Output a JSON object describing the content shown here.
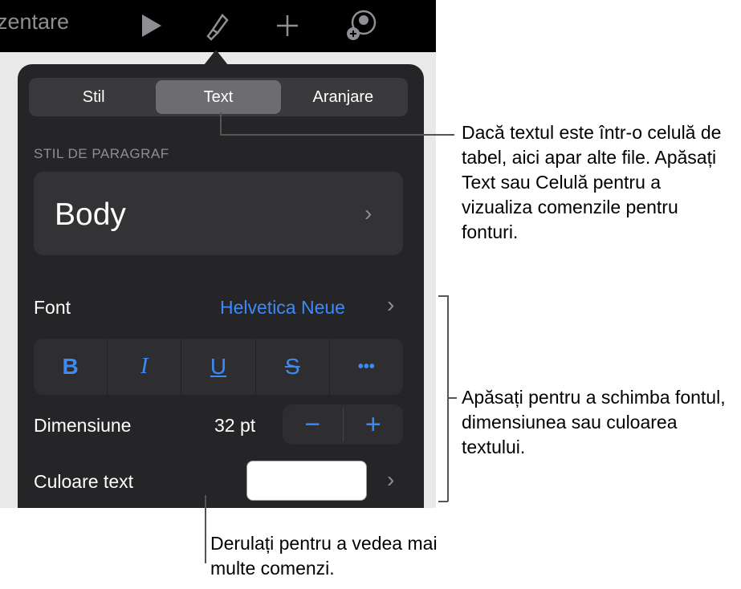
{
  "toolbar": {
    "title_partial": "zentare",
    "icons": [
      "play-icon",
      "paintbrush-icon",
      "plus-icon",
      "add-collaborator-icon"
    ]
  },
  "tabs": [
    {
      "label": "Stil"
    },
    {
      "label": "Text",
      "active": true
    },
    {
      "label": "Aranjare"
    }
  ],
  "paragraph": {
    "section_label": "STIL DE PARAGRAF",
    "value": "Body"
  },
  "font": {
    "label": "Font",
    "value": "Helvetica Neue"
  },
  "format_buttons": [
    {
      "label": "B",
      "name": "bold"
    },
    {
      "label": "I",
      "name": "italic"
    },
    {
      "label": "U",
      "name": "underline"
    },
    {
      "label": "S",
      "name": "strikethrough"
    },
    {
      "label": "•••",
      "name": "more"
    }
  ],
  "size": {
    "label": "Dimensiune",
    "value": "32 pt",
    "minus": "−",
    "plus": "+"
  },
  "color": {
    "label": "Culoare text",
    "value": "#ffffff"
  },
  "accent": "#3d8af7",
  "callouts": {
    "tabs": "Dacă textul este într-o celulă de tabel, aici apar alte file. Apăsați Text sau Celulă pentru a vizualiza comenzile pentru fonturi.",
    "controls": "Apăsați pentru a schimba fontul, dimensiunea sau culoarea textului.",
    "scroll": "Derulați pentru a vedea mai multe comenzi."
  }
}
